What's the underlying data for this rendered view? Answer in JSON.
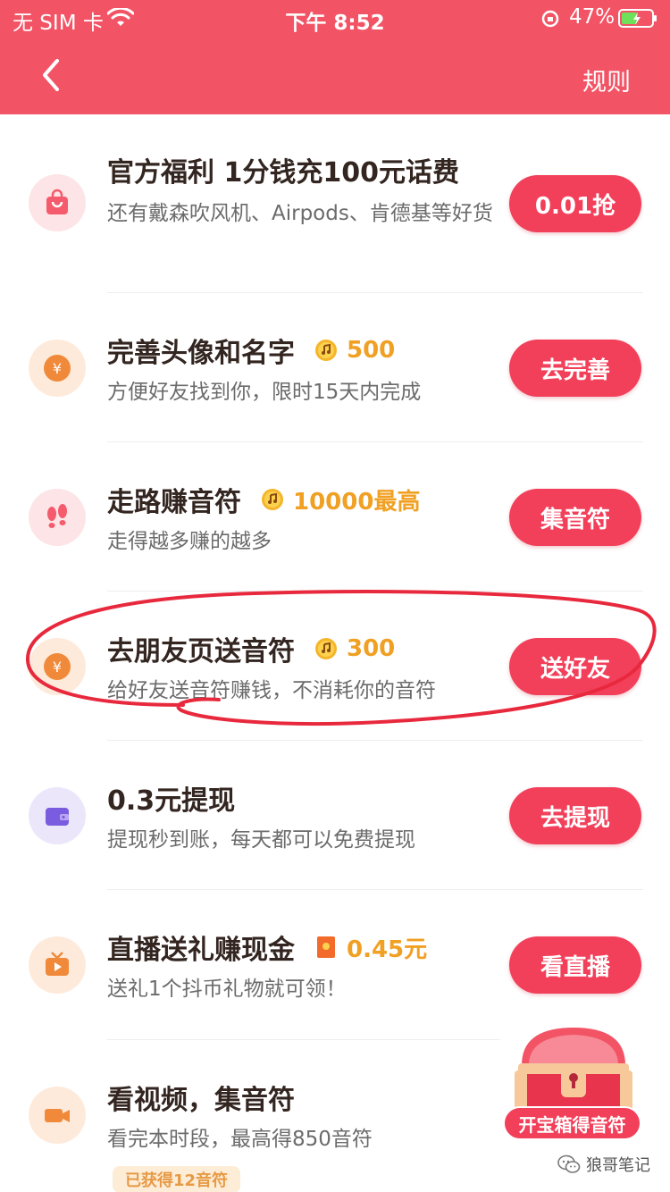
{
  "status_bar": {
    "carrier": "无 SIM 卡",
    "time": "下午 8:52",
    "battery": "47%"
  },
  "nav": {
    "rules_label": "规则"
  },
  "tasks": [
    {
      "title": "官方福利 1分钱充100元话费",
      "description": "还有戴森吹风机、Airpods、肯德基等好货",
      "button": "0.01抢",
      "icon": "shopping-bag-icon"
    },
    {
      "title": "完善头像和名字",
      "reward": "500",
      "description": "方便好友找到你，限时15天内完成",
      "button": "去完善",
      "icon": "yen-coin-icon"
    },
    {
      "title": "走路赚音符",
      "reward": "10000最高",
      "description": "走得越多赚的越多",
      "button": "集音符",
      "icon": "footprints-icon"
    },
    {
      "title": "去朋友页送音符",
      "reward": "300",
      "description": "给好友送音符赚钱，不消耗你的音符",
      "button": "送好友",
      "icon": "yen-coin-icon"
    },
    {
      "title": "0.3元提现",
      "description": "提现秒到账，每天都可以免费提现",
      "button": "去提现",
      "icon": "wallet-icon"
    },
    {
      "title": "直播送礼赚现金",
      "reward": "0.45元",
      "description": "送礼1个抖币礼物就可领！",
      "button": "看直播",
      "icon": "tv-icon"
    },
    {
      "title": "看视频，集音符",
      "description": "看完本时段，最高得850音符",
      "badge": "已获得12音符",
      "icon": "video-camera-icon"
    }
  ],
  "treasure_chest": {
    "label": "开宝箱得音符"
  },
  "watermark": {
    "text": "狼哥笔记"
  },
  "colors": {
    "header": "#f25466",
    "button": "#f23f5a",
    "reward": "#f0a023",
    "highlight_circle": "#e8293d"
  }
}
